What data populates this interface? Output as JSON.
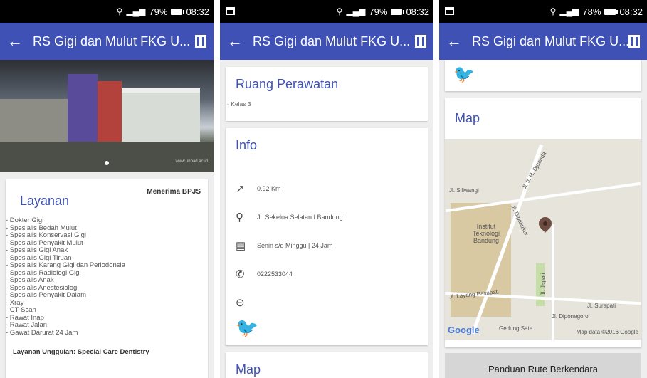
{
  "status": [
    {
      "battery": "79%",
      "time": "08:32"
    },
    {
      "battery": "79%",
      "time": "08:32"
    },
    {
      "battery": "78%",
      "time": "08:32"
    }
  ],
  "appbar": {
    "title": "RS Gigi dan Mulut FKG U..."
  },
  "screen1": {
    "watermark": "www.unpad.ac.id",
    "layanan": {
      "heading": "Layanan",
      "badge": "Menerima BPJS",
      "items": [
        "- Dokter Gigi",
        "- Spesialis Bedah Mulut",
        "- Spesialis Konservasi Gigi",
        "- Spesialis Penyakit Mulut",
        "- Spesialis Gigi Anak",
        "- Spesialis Gigi Tiruan",
        "- Spesialis Karang Gigi dan Periodonsia",
        "- Spesialis Radiologi Gigi",
        "- Spesialis Anak",
        "- Spesialis Anestesiologi",
        "- Spesialis Penyakit Dalam",
        "- Xray",
        "- CT-Scan",
        "- Rawat Inap",
        "- Rawat Jalan",
        "- Gawat Darurat 24 Jam"
      ],
      "unggulan": "Layanan Unggulan: Special Care Dentistry"
    }
  },
  "screen2": {
    "ruang": {
      "heading": "Ruang Perawatan",
      "text": "- Kelas 3"
    },
    "info": {
      "heading": "Info",
      "distance": "0.92 Km",
      "address": "Jl. Sekeloa Selatan I Bandung",
      "hours": "Senin s/d Minggu | 24 Jam",
      "phone": "0222533044"
    },
    "map_heading": "Map"
  },
  "screen3": {
    "map_heading": "Map",
    "map_labels": {
      "siliwangi": "Jl. Siliwangi",
      "djuanda": "Jl. Ir. H. Djuanda",
      "itb": "Institut Teknologi Bandung",
      "dipatiukur": "Jl. Dipatiukur",
      "japati": "Jl. Japati",
      "layang": "Jl. Layang Pasupati",
      "surapati": "Jl. Surapati",
      "diponegoro": "Jl. Diponegoro",
      "gedung_sate": "Gedung Sate",
      "google": "Google",
      "mapdata": "Map data ©2016 Google"
    },
    "route_button": "Panduan Rute Berkendara"
  }
}
